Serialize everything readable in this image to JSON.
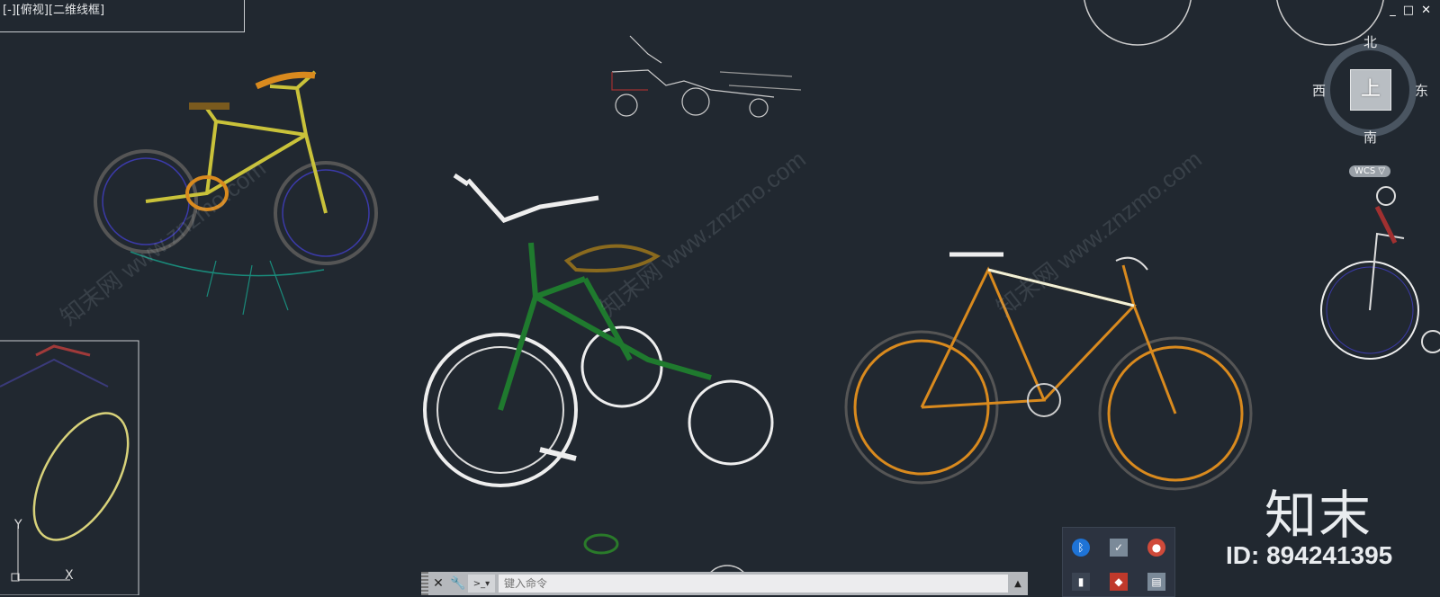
{
  "viewport": {
    "label": "[-][俯视][二维线框]"
  },
  "window_controls": {
    "minimize": "_",
    "restore": "□",
    "close": "✕"
  },
  "viewcube": {
    "north": "北",
    "south": "南",
    "east": "东",
    "west": "西",
    "top_face": "上",
    "wcs": "WCS ▽"
  },
  "command_line": {
    "close_glyph": "✕",
    "settings_glyph": "🔧",
    "prompt_glyph": ">_▾",
    "placeholder": "键入命令",
    "expand_glyph": "▲"
  },
  "tray": {
    "icons": [
      "bluetooth-icon",
      "network-icon",
      "color-picker-icon",
      "bookmark-icon",
      "security-icon",
      "clipboard-icon"
    ]
  },
  "watermark": {
    "brand": "知末",
    "id": "ID: 894241395",
    "site": "知末网 www.znzmo.com"
  },
  "colors": {
    "background": "#212830",
    "frame_orange": "#d98a1e",
    "frame_yellow": "#c9c23a",
    "frame_green": "#1f7a2e",
    "spokes_blue": "#3b3aa8",
    "line_white": "#e8e8e8"
  }
}
